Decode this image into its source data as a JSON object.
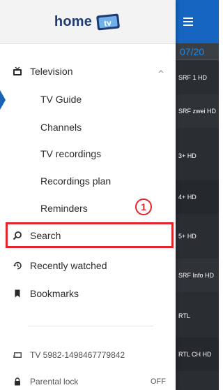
{
  "app": {
    "logo_text": "home",
    "logo_badge": "tv"
  },
  "menu": {
    "television": "Television",
    "tv_guide": "TV Guide",
    "channels": "Channels",
    "tv_recordings": "TV recordings",
    "recordings_plan": "Recordings plan",
    "reminders": "Reminders",
    "search": "Search",
    "recently_watched": "Recently watched",
    "bookmarks": "Bookmarks"
  },
  "footer": {
    "device": "TV 5982-1498467779842",
    "parental_lock": "Parental lock",
    "parental_lock_state": "OFF"
  },
  "annotation": {
    "step": "1"
  },
  "background": {
    "date": "07/20",
    "channels": [
      "SRF 1 HD",
      "SRF zwei HD",
      "3+ HD",
      "4+ HD",
      "5+ HD",
      "SRF Info HD",
      "RTL",
      "RTL CH HD"
    ]
  },
  "colors": {
    "accent": "#1565c0",
    "highlight": "#e2232a",
    "logo": "#1f3b74"
  }
}
